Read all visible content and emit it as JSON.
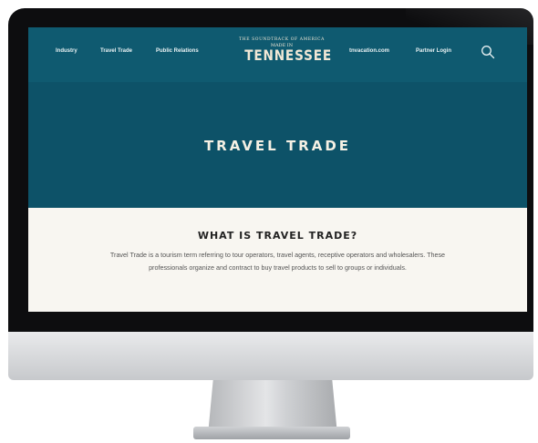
{
  "nav": {
    "links": [
      "Industry",
      "Travel Trade",
      "Public Relations",
      "tnvacation.com",
      "Partner Login"
    ]
  },
  "logo": {
    "arc_text": "THE SOUNDTRACK OF AMERICA",
    "made_in": "MADE IN",
    "main": "TENNESSEE"
  },
  "hero": {
    "title": "TRAVEL TRADE"
  },
  "content": {
    "title": "WHAT IS TRAVEL TRADE?",
    "body": "Travel Trade is a tourism term referring to tour operators, travel agents, receptive operators and wholesalers. These professionals organize and contract to buy travel products to sell to groups or individuals."
  },
  "colors": {
    "nav_bg": "#0f5a70",
    "hero_bg": "#0d5268",
    "content_bg": "#f8f6f1"
  },
  "icons": {
    "search": "search-icon"
  }
}
